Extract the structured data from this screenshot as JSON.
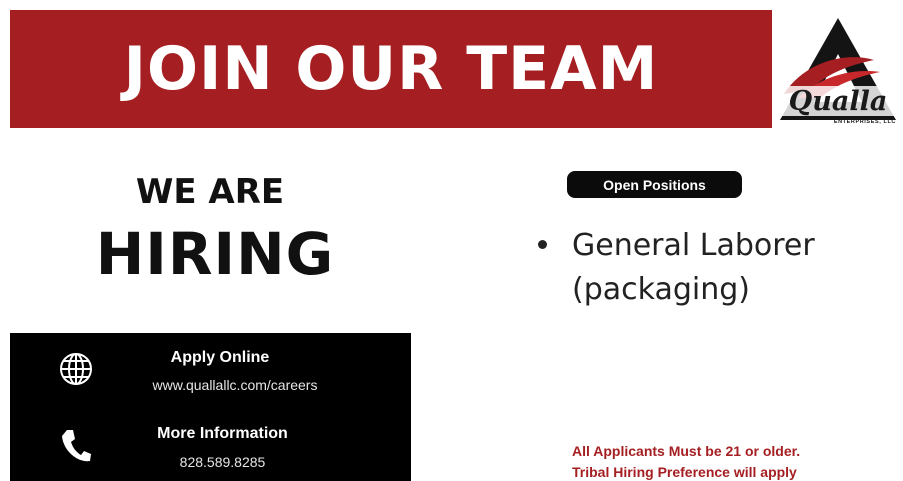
{
  "banner": {
    "title": "JOIN OUR TEAM"
  },
  "logo": {
    "name": "Qualla",
    "subtitle": "ENTERPRISES, LLC"
  },
  "headline": {
    "line1": "WE ARE",
    "line2": "HIRING"
  },
  "positions": {
    "label": "Open Positions",
    "items": [
      {
        "line1": "General Laborer",
        "line2": "(packaging)"
      }
    ]
  },
  "contact": {
    "apply": {
      "title": "Apply Online",
      "value": "www.quallallc.com/careers",
      "icon": "globe-icon"
    },
    "info": {
      "title": "More Information",
      "value": "828.589.8285",
      "icon": "phone-icon"
    }
  },
  "notice": {
    "line1": "All Applicants Must be 21 or older.",
    "line2": "Tribal Hiring Preference will apply"
  },
  "colors": {
    "brand_red": "#a51f22",
    "black": "#000000",
    "white": "#ffffff"
  }
}
